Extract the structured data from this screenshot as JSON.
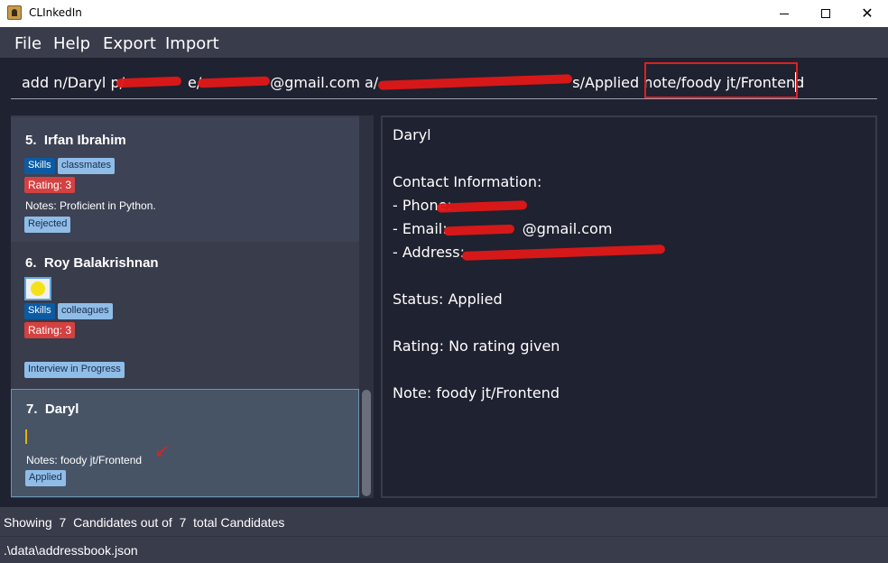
{
  "window": {
    "title": "CLInkedIn",
    "close_glyph": "✕"
  },
  "menu": [
    "File",
    "Help",
    "Export",
    "Import"
  ],
  "command": {
    "p1": "add n/Daryl p/",
    "p2": "e/",
    "p3": "@gmail.com a/",
    "p4": " s/Applied ",
    "p5": "note/foody jt/Frontend"
  },
  "candidates": [
    {
      "index": "5.",
      "name": "Irfan Ibrahim",
      "tags": [
        "Skills",
        "classmates"
      ],
      "rating": "Rating: 3",
      "notes": "Notes: Proficient in Python.",
      "status": "Rejected"
    },
    {
      "index": "6.",
      "name": "Roy Balakrishnan",
      "tags": [
        "Skills",
        "colleagues"
      ],
      "rating": "Rating: 3",
      "status": "Interview in Progress"
    },
    {
      "index": "7.",
      "name": "Daryl",
      "notes": "Notes: foody jt/Frontend",
      "status": "Applied",
      "annotation_arrow": "↙"
    }
  ],
  "details": {
    "name": "Daryl",
    "contact_heading": "Contact Information:",
    "phone_label": "- Phone: ",
    "email_label": "- Email: ",
    "email_suffix": "@gmail.com",
    "address_label": "- Address: ",
    "status": "Status: Applied",
    "rating": "Rating: No rating given",
    "note": "Note: foody jt/Frontend"
  },
  "status_bar": {
    "showing": "Showing",
    "shown": "7",
    "mid": "Candidates out of",
    "total": "7",
    "end": "total Candidates"
  },
  "path": ".\\data\\addressbook.json",
  "colors": {
    "redaction": "#e01818",
    "rating_tag": "#d44141",
    "skills_tag": "#0b5ba4",
    "light_tag": "#8fbde8"
  }
}
